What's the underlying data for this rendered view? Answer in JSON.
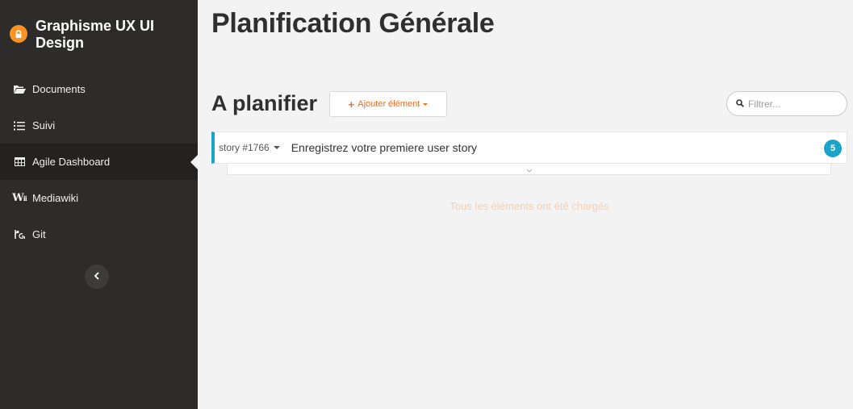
{
  "project": {
    "name": "Graphisme UX UI Design",
    "icon": "lock-icon",
    "color": "#f79422"
  },
  "sidebar": {
    "items": [
      {
        "label": "Documents",
        "icon": "folder-open-icon"
      },
      {
        "label": "Suivi",
        "icon": "list-icon"
      },
      {
        "label": "Agile Dashboard",
        "icon": "table-icon",
        "active": true
      },
      {
        "label": "Mediawiki",
        "icon": "wiki-icon"
      },
      {
        "label": "Git",
        "icon": "git-icon"
      }
    ],
    "collapse_icon": "chevron-left-icon"
  },
  "page": {
    "title": "Planification Générale"
  },
  "backlog": {
    "title": "A planifier",
    "add_button": {
      "plus": "+",
      "label": "Ajouter élément",
      "icon": "caret-down-icon"
    },
    "filter": {
      "placeholder": "Filtrer...",
      "value": "",
      "icon": "search-icon"
    },
    "items": [
      {
        "ref": "story #1766",
        "title": "Enregistrez votre premiere user story",
        "points": "5",
        "accent": "#1aa4c8"
      }
    ],
    "expand_icon": "chevron-down-icon",
    "status": "Tous les éléments ont été chargés"
  },
  "colors": {
    "sidebar_bg": "#2d2c2a",
    "accent_orange": "#f26d21",
    "accent_blue": "#1aa4c8"
  }
}
